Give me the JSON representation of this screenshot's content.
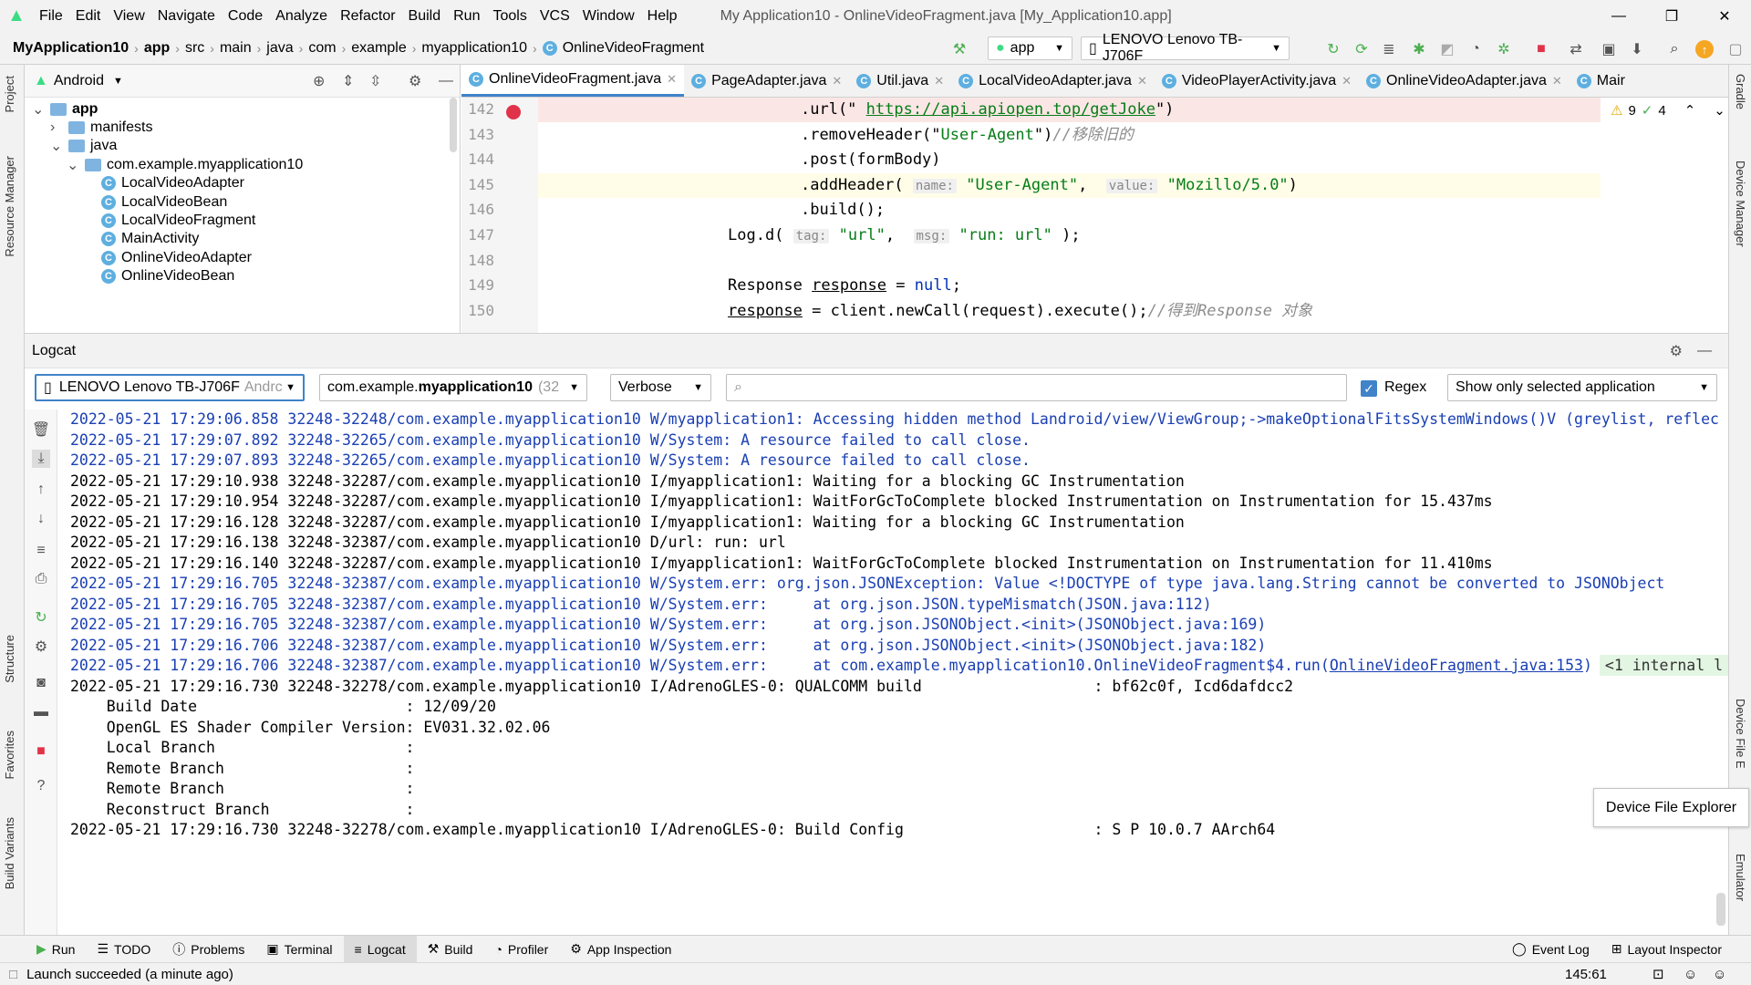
{
  "menu": {
    "items": [
      "File",
      "Edit",
      "View",
      "Navigate",
      "Code",
      "Analyze",
      "Refactor",
      "Build",
      "Run",
      "Tools",
      "VCS",
      "Window",
      "Help"
    ],
    "window_title": "My Application10 - OnlineVideoFragment.java [My_Application10.app]"
  },
  "nav": {
    "breadcrumb": [
      "MyApplication10",
      "app",
      "src",
      "main",
      "java",
      "com",
      "example",
      "myapplication10",
      "OnlineVideoFragment"
    ],
    "run_config": "app",
    "device": "LENOVO Lenovo TB-J706F"
  },
  "project": {
    "view": "Android",
    "tree": [
      {
        "label": "app",
        "kind": "module"
      },
      {
        "label": "manifests",
        "kind": "folder"
      },
      {
        "label": "java",
        "kind": "folder"
      },
      {
        "label": "com.example.myapplication10",
        "kind": "package"
      },
      {
        "label": "LocalVideoAdapter",
        "kind": "class"
      },
      {
        "label": "LocalVideoBean",
        "kind": "class"
      },
      {
        "label": "LocalVideoFragment",
        "kind": "class"
      },
      {
        "label": "MainActivity",
        "kind": "class"
      },
      {
        "label": "OnlineVideoAdapter",
        "kind": "class"
      },
      {
        "label": "OnlineVideoBean",
        "kind": "class"
      }
    ]
  },
  "editor": {
    "tabs": [
      "OnlineVideoFragment.java",
      "PageAdapter.java",
      "Util.java",
      "LocalVideoAdapter.java",
      "VideoPlayerActivity.java",
      "OnlineVideoAdapter.java",
      "Mair"
    ],
    "inspections": {
      "warnings": "9",
      "weak_warnings": "4"
    },
    "lines": [
      {
        "n": "142",
        "seg": [
          [
            "",
            ".url(\" "
          ],
          [
            "str-u",
            "https://api.apiopen.top/getJoke"
          ],
          [
            "",
            "\")"
          ]
        ]
      },
      {
        "n": "143",
        "seg": [
          [
            "",
            ".removeHeader(\""
          ],
          [
            "str",
            "User-Agent"
          ],
          [
            "",
            "\")"
          ],
          [
            "cmt",
            "//移除旧的"
          ]
        ]
      },
      {
        "n": "144",
        "seg": [
          [
            "",
            ".post(formBody)"
          ]
        ]
      },
      {
        "n": "145",
        "seg": [
          [
            "",
            ".addHeader( "
          ],
          [
            "hint",
            "name:"
          ],
          [
            "",
            " "
          ],
          [
            "str",
            "\"User-Agent\""
          ],
          [
            "",
            ",  "
          ],
          [
            "hint",
            "value:"
          ],
          [
            "",
            " "
          ],
          [
            "str",
            "\"Mozillo/5.0\""
          ],
          [
            "",
            ")"
          ]
        ]
      },
      {
        "n": "146",
        "seg": [
          [
            "",
            ".build();"
          ]
        ]
      },
      {
        "n": "147",
        "seg": [
          [
            "",
            "Log.d( "
          ],
          [
            "hint",
            "tag:"
          ],
          [
            "",
            " "
          ],
          [
            "str",
            "\"url\""
          ],
          [
            "",
            ",  "
          ],
          [
            "hint",
            "msg:"
          ],
          [
            "",
            " "
          ],
          [
            "str",
            "\"run: url\""
          ],
          [
            "",
            " );"
          ]
        ]
      },
      {
        "n": "148",
        "seg": [
          [
            "",
            ""
          ]
        ]
      },
      {
        "n": "149",
        "seg": [
          [
            "",
            "Response "
          ],
          [
            "u",
            "response"
          ],
          [
            "",
            " = "
          ],
          [
            "kw",
            "null"
          ],
          [
            "",
            ";"
          ]
        ]
      },
      {
        "n": "150",
        "seg": [
          [
            "u",
            "response"
          ],
          [
            "",
            " = client.newCall(request).execute();"
          ],
          [
            "cmt",
            "//得到Response 对象"
          ]
        ]
      }
    ]
  },
  "logcat": {
    "title": "Logcat",
    "device_filter": "LENOVO Lenovo TB-J706F",
    "device_filter_suffix": "Andrc",
    "package_prefix": "com.example.",
    "package_bold": "myapplication10",
    "package_suffix": "(32",
    "level": "Verbose",
    "search_placeholder": "",
    "regex_label": "Regex",
    "scope": "Show only selected application",
    "lines": [
      {
        "t": "w",
        "text": "2022-05-21 17:29:06.858 32248-32248/com.example.myapplication10 W/myapplication1: Accessing hidden method Landroid/view/ViewGroup;->makeOptionalFitsSystemWindows()V (greylist, reflec"
      },
      {
        "t": "w",
        "text": "2022-05-21 17:29:07.892 32248-32265/com.example.myapplication10 W/System: A resource failed to call close."
      },
      {
        "t": "w",
        "text": "2022-05-21 17:29:07.893 32248-32265/com.example.myapplication10 W/System: A resource failed to call close."
      },
      {
        "t": "i",
        "text": "2022-05-21 17:29:10.938 32248-32287/com.example.myapplication10 I/myapplication1: Waiting for a blocking GC Instrumentation"
      },
      {
        "t": "i",
        "text": "2022-05-21 17:29:10.954 32248-32287/com.example.myapplication10 I/myapplication1: WaitForGcToComplete blocked Instrumentation on Instrumentation for 15.437ms"
      },
      {
        "t": "i",
        "text": "2022-05-21 17:29:16.128 32248-32287/com.example.myapplication10 I/myapplication1: Waiting for a blocking GC Instrumentation"
      },
      {
        "t": "i",
        "text": "2022-05-21 17:29:16.138 32248-32387/com.example.myapplication10 D/url: run: url"
      },
      {
        "t": "i",
        "text": "2022-05-21 17:29:16.140 32248-32287/com.example.myapplication10 I/myapplication1: WaitForGcToComplete blocked Instrumentation on Instrumentation for 11.410ms"
      },
      {
        "t": "w",
        "text": "2022-05-21 17:29:16.705 32248-32387/com.example.myapplication10 W/System.err: org.json.JSONException: Value <!DOCTYPE of type java.lang.String cannot be converted to JSONObject"
      },
      {
        "t": "w",
        "text": "2022-05-21 17:29:16.705 32248-32387/com.example.myapplication10 W/System.err:     at org.json.JSON.typeMismatch(JSON.java:112)"
      },
      {
        "t": "w",
        "text": "2022-05-21 17:29:16.705 32248-32387/com.example.myapplication10 W/System.err:     at org.json.JSONObject.<init>(JSONObject.java:169)"
      },
      {
        "t": "w",
        "text": "2022-05-21 17:29:16.706 32248-32387/com.example.myapplication10 W/System.err:     at org.json.JSONObject.<init>(JSONObject.java:182)"
      },
      {
        "t": "w",
        "text": "2022-05-21 17:29:16.706 32248-32387/com.example.myapplication10 W/System.err:     at com.example.myapplication10.OnlineVideoFragment$4.run(",
        "link": "OnlineVideoFragment.java:153",
        "after": ")",
        "badge": "<1 internal l"
      },
      {
        "t": "i",
        "text": "2022-05-21 17:29:16.730 32248-32278/com.example.myapplication10 I/AdrenoGLES-0: QUALCOMM build                   : bf62c0f, Icd6dafdcc2"
      },
      {
        "t": "i",
        "text": "    Build Date                       : 12/09/20"
      },
      {
        "t": "i",
        "text": "    OpenGL ES Shader Compiler Version: EV031.32.02.06"
      },
      {
        "t": "i",
        "text": "    Local Branch                     :"
      },
      {
        "t": "i",
        "text": "    Remote Branch                    :"
      },
      {
        "t": "i",
        "text": "    Remote Branch                    :"
      },
      {
        "t": "i",
        "text": "    Reconstruct Branch               :"
      },
      {
        "t": "i",
        "text": "2022-05-21 17:29:16.730 32248-32278/com.example.myapplication10 I/AdrenoGLES-0: Build Config                     : S P 10.0.7 AArch64"
      }
    ]
  },
  "left_strip": [
    "Project",
    "Resource Manager",
    "Structure",
    "Favorites",
    "Build Variants"
  ],
  "right_strip": [
    "Gradle",
    "Device Manager",
    "Device File E",
    "Emulator"
  ],
  "bottom_tools": [
    "Run",
    "TODO",
    "Problems",
    "Terminal",
    "Logcat",
    "Build",
    "Profiler",
    "App Inspection"
  ],
  "bottom_tools_right": [
    "Event Log",
    "Layout Inspector"
  ],
  "status": {
    "message": "Launch succeeded (a minute ago)",
    "position": "145:61"
  },
  "tooltip": "Device File Explorer",
  "colors": {
    "warn_log": "#1a3fb3",
    "accent": "#4083c9",
    "breakpoint": "#e0334a",
    "android_green": "#3ddc84"
  }
}
